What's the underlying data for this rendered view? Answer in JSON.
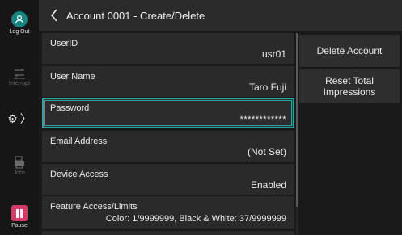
{
  "rail": {
    "logout_label": "Log Out",
    "interrupt_label": "Interrupt",
    "jobs_label": "Jobs",
    "pause_label": "Pause"
  },
  "header": {
    "title": "Account 0001 - Create/Delete"
  },
  "rows": [
    {
      "label": "UserID",
      "value": "usr01"
    },
    {
      "label": "User Name",
      "value": "Taro Fuji"
    },
    {
      "label": "Password",
      "value": "************"
    },
    {
      "label": "Email Address",
      "value": "(Not Set)"
    },
    {
      "label": "Device Access",
      "value": "Enabled"
    },
    {
      "label": "Feature Access/Limits",
      "value": "Color: 1/9999999, Black & White: 37/9999999"
    }
  ],
  "buttons": {
    "delete_account": "Delete Account",
    "reset_line1": "Reset Total",
    "reset_line2": "Impressions"
  },
  "colors": {
    "accent": "#2aa6a0",
    "logout": "#14857f",
    "pause": "#d63a66"
  }
}
